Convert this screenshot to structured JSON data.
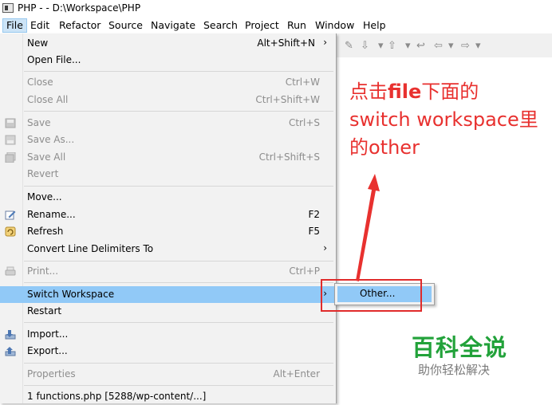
{
  "window": {
    "title": "PHP - - D:\\Workspace\\PHP"
  },
  "menubar": {
    "items": [
      "File",
      "Edit",
      "Refactor",
      "Source",
      "Navigate",
      "Search",
      "Project",
      "Run",
      "Window",
      "Help"
    ],
    "active": "File"
  },
  "file_menu": {
    "new": {
      "label": "New",
      "shortcut": "Alt+Shift+N",
      "submenu_arrow": "›"
    },
    "open_file": {
      "label": "Open File..."
    },
    "close": {
      "label": "Close",
      "shortcut": "Ctrl+W"
    },
    "close_all": {
      "label": "Close All",
      "shortcut": "Ctrl+Shift+W"
    },
    "save": {
      "label": "Save",
      "shortcut": "Ctrl+S"
    },
    "save_as": {
      "label": "Save As..."
    },
    "save_all": {
      "label": "Save All",
      "shortcut": "Ctrl+Shift+S"
    },
    "revert": {
      "label": "Revert"
    },
    "move": {
      "label": "Move..."
    },
    "rename": {
      "label": "Rename...",
      "shortcut": "F2"
    },
    "refresh": {
      "label": "Refresh",
      "shortcut": "F5"
    },
    "convert": {
      "label": "Convert Line Delimiters To",
      "submenu_arrow": "›"
    },
    "print": {
      "label": "Print...",
      "shortcut": "Ctrl+P"
    },
    "switch_workspace": {
      "label": "Switch Workspace",
      "submenu_arrow": "›"
    },
    "restart": {
      "label": "Restart"
    },
    "import": {
      "label": "Import..."
    },
    "export": {
      "label": "Export..."
    },
    "properties": {
      "label": "Properties",
      "shortcut": "Alt+Enter"
    },
    "recent": {
      "label": "1 functions.php  [5288/wp-content/...]"
    }
  },
  "switch_workspace_submenu": {
    "other": "Other..."
  },
  "annotation": {
    "line1_a": "点击",
    "line1_b": "file",
    "line1_c": "下面的",
    "line2_a": "switch workspace",
    "line2_b": "里",
    "line3_a": "的",
    "line3_b": "other"
  },
  "watermark": {
    "title": "百科全说",
    "subtitle": "助你轻松解决"
  },
  "colors": {
    "highlight": "#91c9f7",
    "annotation_red": "#e8312f",
    "watermark_green": "#22a23a"
  }
}
